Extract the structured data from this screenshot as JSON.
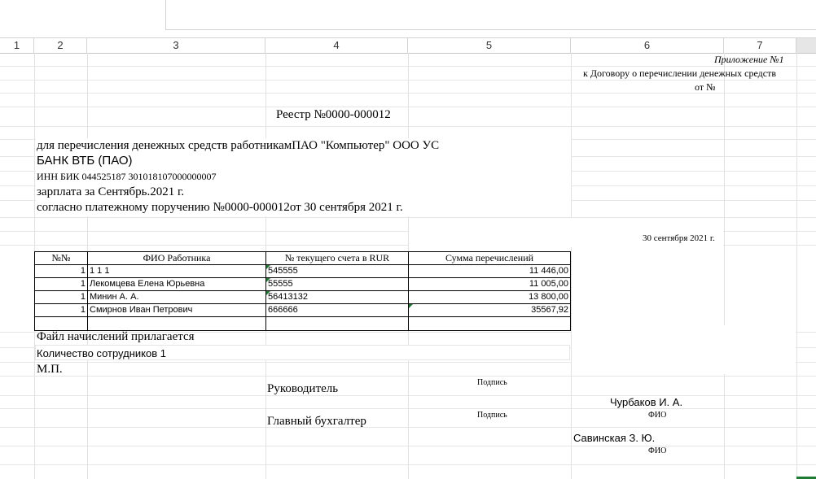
{
  "columns": [
    "1",
    "2",
    "3",
    "4",
    "5",
    "6",
    "7"
  ],
  "appendix": {
    "line1": "Приложение №1",
    "line2": "к Договору о перечислении денежных средств",
    "line3": "от  №"
  },
  "registry": {
    "title": "Реестр №0000-000012",
    "purpose_line": "для перечисления денежных средств работникамПАО \"Компьютер\" ООО УС",
    "bank": "БАНК ВТБ (ПАО)",
    "inn_line": "ИНН БИК 044525187 301018107000000007",
    "salary_line": "зарплата за Сентябрь.2021 г.",
    "order_line": "согласно платежному поручению №0000-000012от 30 сентября 2021 г.",
    "date": "30 сентября 2021 г."
  },
  "table": {
    "headers": [
      "№№",
      "ФИО Работника",
      "№ текущего счета в RUR",
      "Сумма перечислений"
    ],
    "rows": [
      {
        "n": "1",
        "name": "1 1 1",
        "account": "545555",
        "amount": "11 446,00"
      },
      {
        "n": "1",
        "name": "Лекомцева Елена Юрьевна",
        "account": "55555",
        "amount": "11 005,00"
      },
      {
        "n": "1",
        "name": "Минин А. А.",
        "account": "56413132",
        "amount": "13 800,00"
      },
      {
        "n": "1",
        "name": "Смирнов Иван Петрович",
        "account": "666666",
        "amount": "35567,92"
      }
    ]
  },
  "footer": {
    "attached": "Файл начислений прилагается",
    "count": "Количество сотрудников 1",
    "stamp": "М.П.",
    "director_label": "Руководитель",
    "signature1": "Подпись",
    "director_name": "Чурбаков И. А.",
    "fio1": "ФИО",
    "accountant_label": "Главный бухгалтер",
    "signature2": "Подпись",
    "accountant_name": "Савинская З. Ю.",
    "fio2": "ФИО"
  }
}
